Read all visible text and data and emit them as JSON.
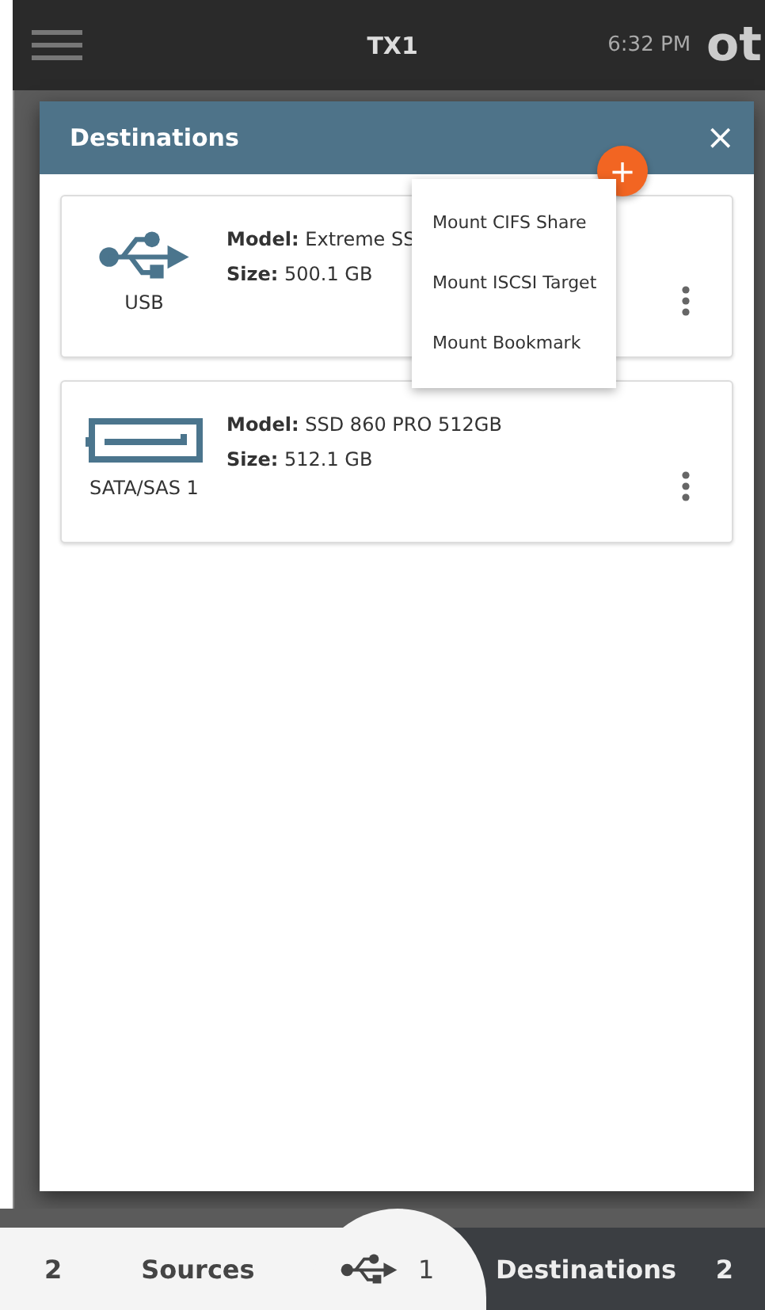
{
  "top_bar": {
    "title": "TX1",
    "time": "6:32 PM",
    "logo": "ot"
  },
  "dialog": {
    "title": "Destinations",
    "close": "×",
    "add": "+",
    "menu": [
      "Mount CIFS Share",
      "Mount ISCSI Target",
      "Mount Bookmark"
    ],
    "devices": [
      {
        "kind": "usb",
        "label": "USB",
        "model": "**Model:** Extreme SS",
        "size": "**Size:** 500.1 GB"
      },
      {
        "kind": "sata",
        "label": "SATA/SAS 1",
        "model": "**Model:** SSD 860 PRO 512GB",
        "size": "**Size:** 512.1 GB"
      }
    ]
  },
  "bottom_nav": {
    "tabs": [
      {
        "kind": "sources",
        "count": "2",
        "label": "Sources",
        "selected": false
      },
      {
        "kind": "usb",
        "count": "1",
        "selected": false
      },
      {
        "kind": "destinations",
        "label": "Destinations",
        "count": "2",
        "selected": true
      }
    ]
  }
}
